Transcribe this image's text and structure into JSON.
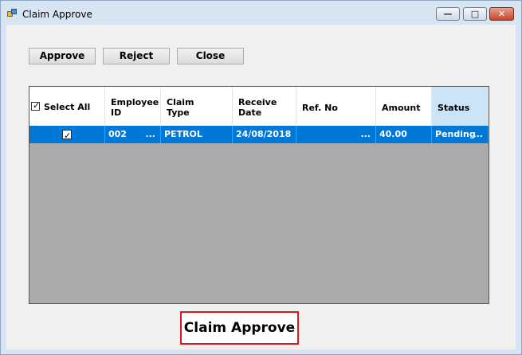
{
  "window": {
    "title": "Claim Approve",
    "controls": {
      "minimize": "—",
      "maximize": "□",
      "close": "✕"
    }
  },
  "toolbar": {
    "approve_label": "Approve",
    "reject_label": "Reject",
    "close_label": "Close"
  },
  "grid": {
    "select_all_label": "Select All",
    "select_all_checked": true,
    "columns": [
      {
        "label": "Employee ID",
        "line1": "Employee",
        "line2": "ID"
      },
      {
        "label": "Claim Type",
        "line1": "Claim",
        "line2": "Type"
      },
      {
        "label": "Receive Date",
        "line1": "Receive",
        "line2": "Date"
      },
      {
        "label": "Ref. No",
        "line1": "Ref. No",
        "line2": ""
      },
      {
        "label": "Amount",
        "line1": "Amount",
        "line2": ""
      },
      {
        "label": "Status",
        "line1": "Status",
        "line2": ""
      }
    ],
    "rows": [
      {
        "checked": true,
        "employee_id": "002",
        "employee_id_ellipsis": "...",
        "claim_type": "PETROL",
        "receive_date": "24/08/2018",
        "ref_no": "",
        "ref_no_ellipsis": "...",
        "amount": "40.00",
        "status": "Pending",
        "status_ellipsis": "..."
      }
    ]
  },
  "caption": "Claim Approve",
  "colors": {
    "row_selected": "#0078d7",
    "status_header": "#cce4f7",
    "grid_empty": "#ababab",
    "caption_border": "#d71920"
  }
}
